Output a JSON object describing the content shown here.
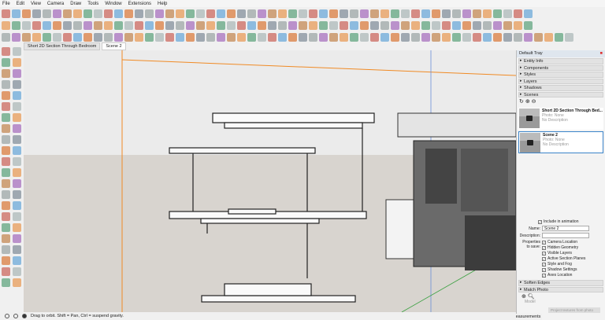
{
  "menu": [
    "File",
    "Edit",
    "View",
    "Camera",
    "Draw",
    "Tools",
    "Window",
    "Extensions",
    "Help"
  ],
  "scene_tabs": [
    {
      "label": "Short 2D Section Through Bedroom",
      "active": false
    },
    {
      "label": "Scene 2",
      "active": true
    }
  ],
  "tray": {
    "title": "Default Tray",
    "panels": [
      "Entity Info",
      "Components",
      "Styles",
      "Layers",
      "Shadows",
      "Scenes"
    ],
    "scenes": [
      {
        "name": "Short 2D Section Through Bed...",
        "photo": "Photo: None",
        "desc": "No Description"
      },
      {
        "name": "Scene 2",
        "photo": "Photo: None",
        "desc": "No Description"
      }
    ],
    "include_animation": "Include in animation",
    "name_label": "Name:",
    "name_value": "Scene 2",
    "desc_label": "Description:",
    "props_label": "Properties to save:",
    "props": [
      "Camera Location",
      "Hidden Geometry",
      "Visible Layers",
      "Active Section Planes",
      "Style and Fog",
      "Shadow Settings",
      "Axes Location"
    ],
    "panels_bottom": [
      "Soften Edges",
      "Match Photo"
    ],
    "model_label": "Model",
    "project_button": "Project textures from photo"
  },
  "status": {
    "text": "Drag to orbit. Shift = Pan, Ctrl = suspend gravity.",
    "measurements": "Measurements"
  },
  "colors": {
    "accent": "#3b84c9",
    "axis_orange": "#f08a24",
    "axis_green": "#3aa040"
  }
}
